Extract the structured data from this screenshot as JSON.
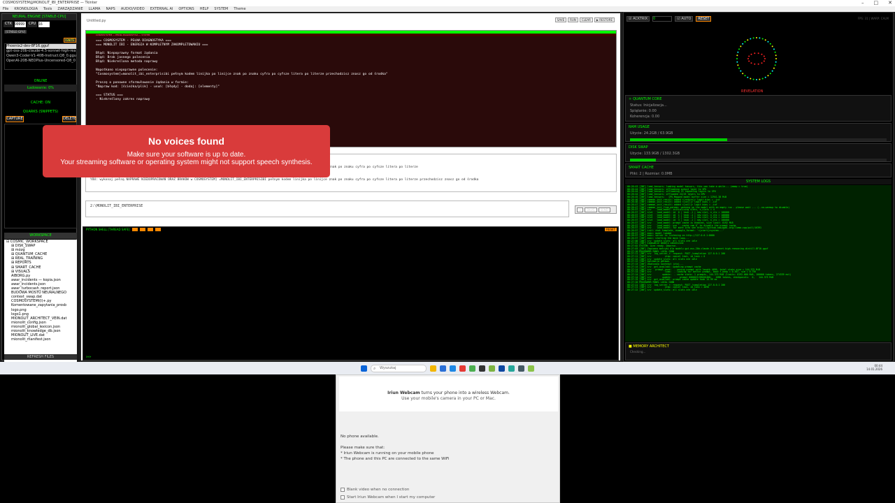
{
  "window": {
    "title": "COSMOSYSTEM@MONOLIT_IBI_ENTERPRISE — Tkinter",
    "menu": [
      "File",
      "KRONOLOGIA",
      "Tools",
      "ZARZĄDZANIE",
      "LLAMA",
      "NAPS",
      "AUDIO/VIDEO",
      "EXTERNAL AI",
      "OPTIONS",
      "HELP",
      "SYSTEM",
      "Theme"
    ]
  },
  "left": {
    "engine_title": "NEURAL ENGINE [STABLE-CPU]",
    "ctx_label": "CTX",
    "ctx_value": "99999",
    "cpu_label": "CPU",
    "cpu_value": "16",
    "mode_chip": "[STABLE-GPU]",
    "ignite": "IGNITE",
    "models": [
      "Phoenix2-dev-8F16.gguf",
      "gpt-oss-20b-claude-4.5-sonnet-high-rea",
      "Qwen3-Coder-V1-40B-Instruct.Q8_0.gguf",
      "OpenAI-20B-NEOPlus-Uncensored-Q8_0"
    ],
    "status": "ONLINE",
    "loading": "Ładowanie: 0%",
    "cache": "CACHE: ON",
    "quarks_title": "QUARKS (SNIPPETS)",
    "capture": "CAPTURE",
    "delete": "DELETE",
    "workspace_title": "WORKSPACE",
    "tree": [
      {
        "d": 0,
        "t": "⊟ COSMIC_WORKSPACE"
      },
      {
        "d": 1,
        "t": "⊞ DISK_SWAP"
      },
      {
        "d": 1,
        "t": "⊞ mózg"
      },
      {
        "d": 1,
        "t": "⊞ QUANTUM_CACHE"
      },
      {
        "d": 1,
        "t": "⊞ REAL_TRAINING"
      },
      {
        "d": 1,
        "t": "⊞ REPORTS"
      },
      {
        "d": 1,
        "t": "⊞ SMART_CACHE"
      },
      {
        "d": 1,
        "t": "⊞ VISUALS"
      },
      {
        "d": 1,
        "t": "AIBORG.py"
      },
      {
        "d": 1,
        "t": "awar_incidents — kopia.json"
      },
      {
        "d": 1,
        "t": "awar_incidents.json"
      },
      {
        "d": 1,
        "t": "awar_turbocash_report.json"
      },
      {
        "d": 1,
        "t": "BUDOWA MOSTU NEURALNEGO"
      },
      {
        "d": 1,
        "t": "context_swap.dat"
      },
      {
        "d": 1,
        "t": "COSMOSYSTEMI(l)+.py"
      },
      {
        "d": 1,
        "t": "Komentowane_zapytania_prosb"
      },
      {
        "d": 1,
        "t": "logo.png"
      },
      {
        "d": 1,
        "t": "logo1.png"
      },
      {
        "d": 1,
        "t": "MIONOLIT_ARCHITECT_VEIN.dat"
      },
      {
        "d": 1,
        "t": "mionolit_config.json"
      },
      {
        "d": 1,
        "t": "mionolit_global_lexicon.json"
      },
      {
        "d": 1,
        "t": "mionolit_knowledge_db.json"
      },
      {
        "d": 1,
        "t": "MIONOLIT_LIVE.dat"
      },
      {
        "d": 1,
        "t": "mionolit_manifest.json"
      }
    ],
    "refresh": "REFRESH FILES"
  },
  "center": {
    "tab": "Untitled.py",
    "tab_buttons": [
      "SAVE",
      "RUN",
      "CLEAR",
      "▶ RESTORE"
    ],
    "diag_subhead": "COSMOSYSTEM — PEŁNA DIAGNOSTYKA — SYSTEM",
    "diag_text": "=== COSMOSYSTEM - PEŁNA DIAGNOSTYKA ===\n=== MONOLIT IBI - ENERGIA W KOMPLETNYM ZAKOMPLETOWANIU ===\n\nBłąd: Niepoprawny format żądania\nBłąd: Brak jasnego polecenia\nBłąd: Niekreślona metoda naprawy\n\nNapotkano niepoprawne polecenie:\n\"Cosmosystem]=monolit_ibi_enterprisibi pełnym kodem linijka po linijce znak po znaku cyfra po cyfsze litera po literze przechodzisz znasz go od środka\"\n\nProszę o ponowne sformułowanie żądania w formie:\n\"Napraw kod: [ścieżka/plik] - usuń: [błędy] - dodaj: [elementy]\"\n\n=== STATUS ===\n- Niekreślony zakres naprawy",
    "chat_text": "YOU: wykonaj pełnym, kodem cosmicsystem MONOLIT_IBI_ENTERPRISE\nAI>\nYOU: wykonaj pełną NAPRAWE NIEDOPRACOWAŃ ORAZ BRAKÓW w COSMOSYSTEM] =MONOLIT_IBI_ENTERPRISIBI pełnym kodem linijka po linijce znak po znaku cyfra po cyfsze litera po literze\nAI>\nAI>\nYOU: wykonaj pełną NAPRAWE NIEDOPRACOWAŃ ORAZ BRAKÓW w COSMOSYSTEM] =MONOLIT_IBI_ENTERPRISIBI pełnym kodem linijka po linijce znak po znaku cyfra po cyfsze litera po literze przechodzisz znasz go od środka",
    "input_value": "2:\\MONOLIT_IBI_ENTERPRISE",
    "send_buttons": [
      "⊖",
      "DŁUG",
      "SEND"
    ],
    "console_title": "PYTHON SHELL [THREAD SAFE]",
    "console_prompt": ">>>",
    "console_reset": "RESET"
  },
  "toast": {
    "title": "No voices found",
    "line1": "Make sure your software is up to date.",
    "line2": "Your streaming software or operating system might not support speech synthesis."
  },
  "right": {
    "acktrix": "ACKTRIX",
    "acktrix_value": "0",
    "auto": "AUTO",
    "reset": "RESET",
    "fps": "FPS: 31 | WARP: CALM",
    "revelation": "REVELATION",
    "quantum": {
      "title": "QUANTUM CORE",
      "l1": "Status: Inicjalizacja...",
      "l2": "Splątanie: 0.00",
      "l3": "Koherencja: 0.00"
    },
    "ram": {
      "title": "RAM USAGE",
      "value": "Użycie: 24.2GB / 63.9GB",
      "fill": 0.38
    },
    "disk": {
      "title": "DISK SWAP",
      "value": "Użycie: 133.9GB / 1302.3GB",
      "fill": 0.1
    },
    "smart": {
      "title": "SMART CACHE",
      "value": "Pliki: 2 | Rozmiar: 0.0MB"
    },
    "logs_title": "SYSTEM LOGS",
    "logs": "00:26:43 [INF] load_tensors: loading model tensors, this can take a while... (mmap = true)\n00:26:44 [INF] load_tensors: offloading output layer to GPU\n00:26:44 [INF] load_tensors: offloading 23 repeating layers to GPU\n00:26:44 [INF] load_tensors: offloaded 24/25 layers to GPU\n00:26:45 [INF] load_tensors:   CPU_Mapped model buffer size = 12941.38 MiB\n00:26:46 [INF] common_init_result: added <|return|> logit bias = -inf\n00:26:46 [INF] common_init_result: added <|call|> logit bias = -inf\n00:26:47 [INF] common_init_result: added <|call|> logit bias = -inf\n00:26:47 [INF] common_init_from_params: warming up the model with an empty run - please wait ... (--no-warmup to disable)\n00:26:57 [INF] srv    load_model: initializing slots, n_slots = 4\n00:26:57 [INF] slot   load_model: id  0 | task -1 | new slot, n_ctx = 100000\n00:26:57 [INF] slot   load_model: id  1 | task -1 | new slot, n_ctx = 100000\n00:26:57 [INF] slot   load_model: id  2 | task -1 | new slot, n_ctx = 100000\n00:26:57 [INF] slot   load_model: id  3 | task -1 | new slot, n_ctx = 100000\n00:26:57 [INF] srv    load_model: prompt cache is enabled, size limit: 8192 MiB\n00:26:57 [INF] srv    load_model: use `--cache-ram 0` to disable the prompt cache\n00:26:57 [INF] srv    load_model: for more info see https://github.com/ggml-org/llama.cpp/pull/16391\n00:26:57 [INF] init: chat template, example_format: '<|start|>system...'\n00:26:57 [INF] main: model loaded\n00:26:57 [INF] main: server is listening on http://127.0.0.1:8080\n00:26:57 [INF] main: starting the main loop...\n00:27:00 [INF] srv  update_slots: all slots are idle\n00:27:01 [INF] Ładowanie modelu zakończone\n00:27:02 SYSTEM: Core ready. Observe.\n00:27:03 [INF] Zapisano metryki dla modelu gpt-oss-20b-claude-4.5-sonnet-high-reasoning-distill.BF16.gguf\n00:27:10 PROGRAMER PANEL LOCAL CONN\n00:27:11 [INF] srv  log_server_r: request: POST /completion 127.0.0.1 200\n00:27:11 [INF] srv          stop: cancel task, id_task = 0\n00:27:12 [INF] srv  update_slots: all slots are idle\n00:27:12 [INF] Aplikacja gotowa.\n00:27:13 [INF] Ukończono kontekst (ctx)...\n00:27:14 [INF] srv  get_availabl: updating prompt cache\n00:27:14 [INF] srv   prompt_save:  - saving prompt with length 4096, total state size = 144.375 MiB\n00:27:14 [INF] srv          load:  - looking for better prompt, base f_keep = 0.367, sim = 0.756\n00:27:14 [INF] srv        update:  - cache state: 1 prompts, 144.375 MiB (limits: 8192.000 MiB, 100000 tokens, 274339 est)\n00:27:14 [INF] srv        update:    - prompt 0000021CE80264D0:   4096 tokens, checkpoints:  0,   144.375 MiB\n00:27:15 [INF] srv  get_availabl: prompt cache update took 14.99 ms\n00:27:20 PROGRAMER PANEL LOCAL CONN\n00:27:21 [INF] srv  log_server_r: request: POST /completion 127.0.0.1 200\n00:27:21 [INF] srv          stop: cancel task, id_task = 4096\n00:27:22 [INF] srv  update_slots: all slots are idle",
    "memarch_title": "■ MEMORY ARCHITECT",
    "memarch_value": "Checking..."
  },
  "taskbar": {
    "search": "Wyszukaj",
    "time": "00:44",
    "date": "14.01.2026"
  },
  "webcam": {
    "brand": "Iriun Webcam",
    "tagline": " turns your phone into a wireless Webcam.",
    "sub": "Use your mobile's camera in your PC or Mac.",
    "no_phone": "No phone available.",
    "make_sure": "Please make sure that:",
    "b1": "* Iriun Webcam is running on your mobile phone",
    "b2": "* The phone and this PC are connected to the same WiFi",
    "c1": "Blank video when no connection",
    "c2": "Start Iriun Webcam when I start my computer"
  }
}
